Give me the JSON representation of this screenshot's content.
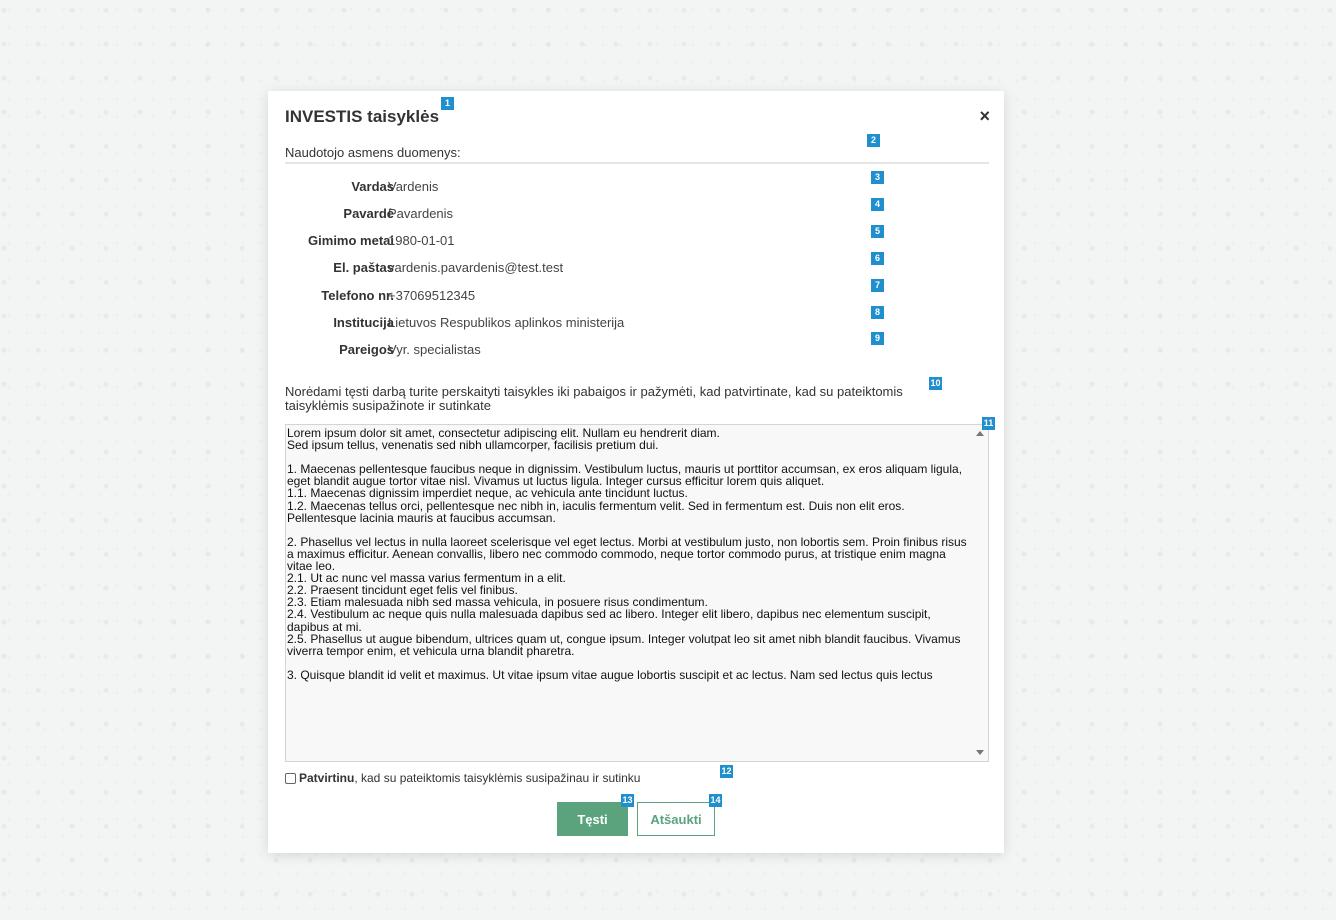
{
  "modal": {
    "title": "INVESTIS taisyklės",
    "close_symbol": "×",
    "section_title": "Naudotojo asmens duomenys:",
    "fields": [
      {
        "label": "Vardas",
        "value": "Vardenis"
      },
      {
        "label": "Pavardė",
        "value": "Pavardenis"
      },
      {
        "label": "Gimimo metai",
        "value": "1980-01-01"
      },
      {
        "label": "El. paštas",
        "value": "vardenis.pavardenis@test.test"
      },
      {
        "label": "Telefono nr.",
        "value": "+37069512345"
      },
      {
        "label": "Institucija",
        "value": "Lietuvos Respublikos aplinkos ministerija"
      },
      {
        "label": "Pareigos",
        "value": "Vyr. specialistas"
      }
    ],
    "notice": "Norėdami tęsti darbą turite perskaityti taisykles iki pabaigos ir pažymėti, kad patvirtinate, kad su pateiktomis taisyklėmis susipažinote ir sutinkate",
    "rules_text": "Lorem ipsum dolor sit amet, consectetur adipiscing elit. Nullam eu hendrerit diam.\nSed ipsum tellus, venenatis sed nibh ullamcorper, facilisis pretium dui.\n\n1. Maecenas pellentesque faucibus neque in dignissim. Vestibulum luctus, mauris ut porttitor accumsan, ex eros aliquam ligula, eget blandit augue tortor vitae nisl. Vivamus ut luctus ligula. Integer cursus efficitur lorem quis aliquet.\n1.1. Maecenas dignissim imperdiet neque, ac vehicula ante tincidunt luctus.\n1.2. Maecenas tellus orci, pellentesque nec nibh in, iaculis fermentum velit. Sed in fermentum est. Duis non elit eros. Pellentesque lacinia mauris at faucibus accumsan.\n\n2. Phasellus vel lectus in nulla laoreet scelerisque vel eget lectus. Morbi at vestibulum justo, non lobortis sem. Proin finibus risus a maximus efficitur. Aenean convallis, libero nec commodo commodo, neque tortor commodo purus, at tristique enim magna vitae leo.\n2.1. Ut ac nunc vel massa varius fermentum in a elit.\n2.2. Praesent tincidunt eget felis vel finibus.\n2.3. Etiam malesuada nibh sed massa vehicula, in posuere risus condimentum.\n2.4. Vestibulum ac neque quis nulla malesuada dapibus sed ac libero. Integer elit libero, dapibus nec elementum suscipit, dapibus at mi.\n2.5. Phasellus ut augue bibendum, ultrices quam ut, congue ipsum. Integer volutpat leo sit amet nibh blandit faucibus. Vivamus viverra tempor enim, et vehicula urna blandit pharetra.\n\n3. Quisque blandit id velit et maximus. Ut vitae ipsum vitae augue lobortis suscipit et ac lectus. Nam sed lectus quis lectus",
    "confirm_bold": "Patvirtinu",
    "confirm_rest": ", kad su pateiktomis taisyklėmis susipažinau ir sutinku",
    "continue_label": "Tęsti",
    "cancel_label": "Atšaukti"
  },
  "badges": [
    "1",
    "2",
    "3",
    "4",
    "5",
    "6",
    "7",
    "8",
    "9",
    "10",
    "11",
    "12",
    "13",
    "14"
  ],
  "colors": {
    "accent": "#5aa37c",
    "badge": "#1f8fce"
  }
}
